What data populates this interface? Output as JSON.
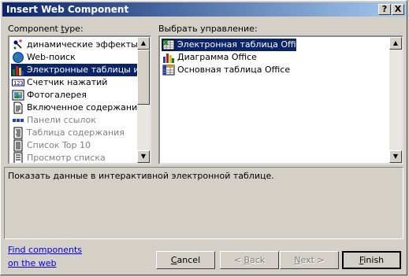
{
  "window": {
    "title": "Insert Web Component",
    "help_glyph": "?",
    "close_glyph": "X"
  },
  "left_panel": {
    "label_prefix": "Component ",
    "label_underlined": "t",
    "label_suffix": "ype:",
    "items": [
      {
        "label": "динамические эффекты",
        "icon": "dynamic-effects-icon"
      },
      {
        "label": "Web-поиск",
        "icon": "web-search-icon"
      },
      {
        "label": "Электронные таблицы и ди",
        "icon": "spreadsheet-chart-icon"
      },
      {
        "label": "Счетчик нажатий",
        "icon": "hit-counter-icon"
      },
      {
        "label": "Фотогалерея",
        "icon": "photo-gallery-icon"
      },
      {
        "label": "Включенное содержание",
        "icon": "included-content-icon"
      },
      {
        "label": "Панели ссылок",
        "icon": "link-bars-icon"
      },
      {
        "label": "Таблица содержания",
        "icon": "table-of-contents-icon"
      },
      {
        "label": "Список Top 10",
        "icon": "top-10-list-icon"
      },
      {
        "label": "Просмотр списка",
        "icon": "list-view-icon"
      }
    ]
  },
  "right_panel": {
    "label": "Выбрать управление:",
    "items": [
      {
        "label": "Электронная таблица Office",
        "icon": "office-spreadsheet-icon"
      },
      {
        "label": "Диаграмма Office",
        "icon": "office-chart-icon"
      },
      {
        "label": "Основная таблица Office",
        "icon": "office-pivottable-icon"
      }
    ]
  },
  "description": "Показать данные в интерактивной электронной таблице.",
  "find_link": {
    "line1": "Find components",
    "line2": "on the web"
  },
  "buttons": {
    "cancel": {
      "u": "C",
      "rest": "ancel"
    },
    "back": {
      "pre": "< ",
      "u": "B",
      "rest": "ack"
    },
    "next": {
      "u": "N",
      "rest": "ext >"
    },
    "finish": {
      "u": "F",
      "rest": "inish"
    }
  },
  "colors": {
    "selection": "#0a246a",
    "face": "#d4d0c8",
    "link": "#0000ee"
  }
}
